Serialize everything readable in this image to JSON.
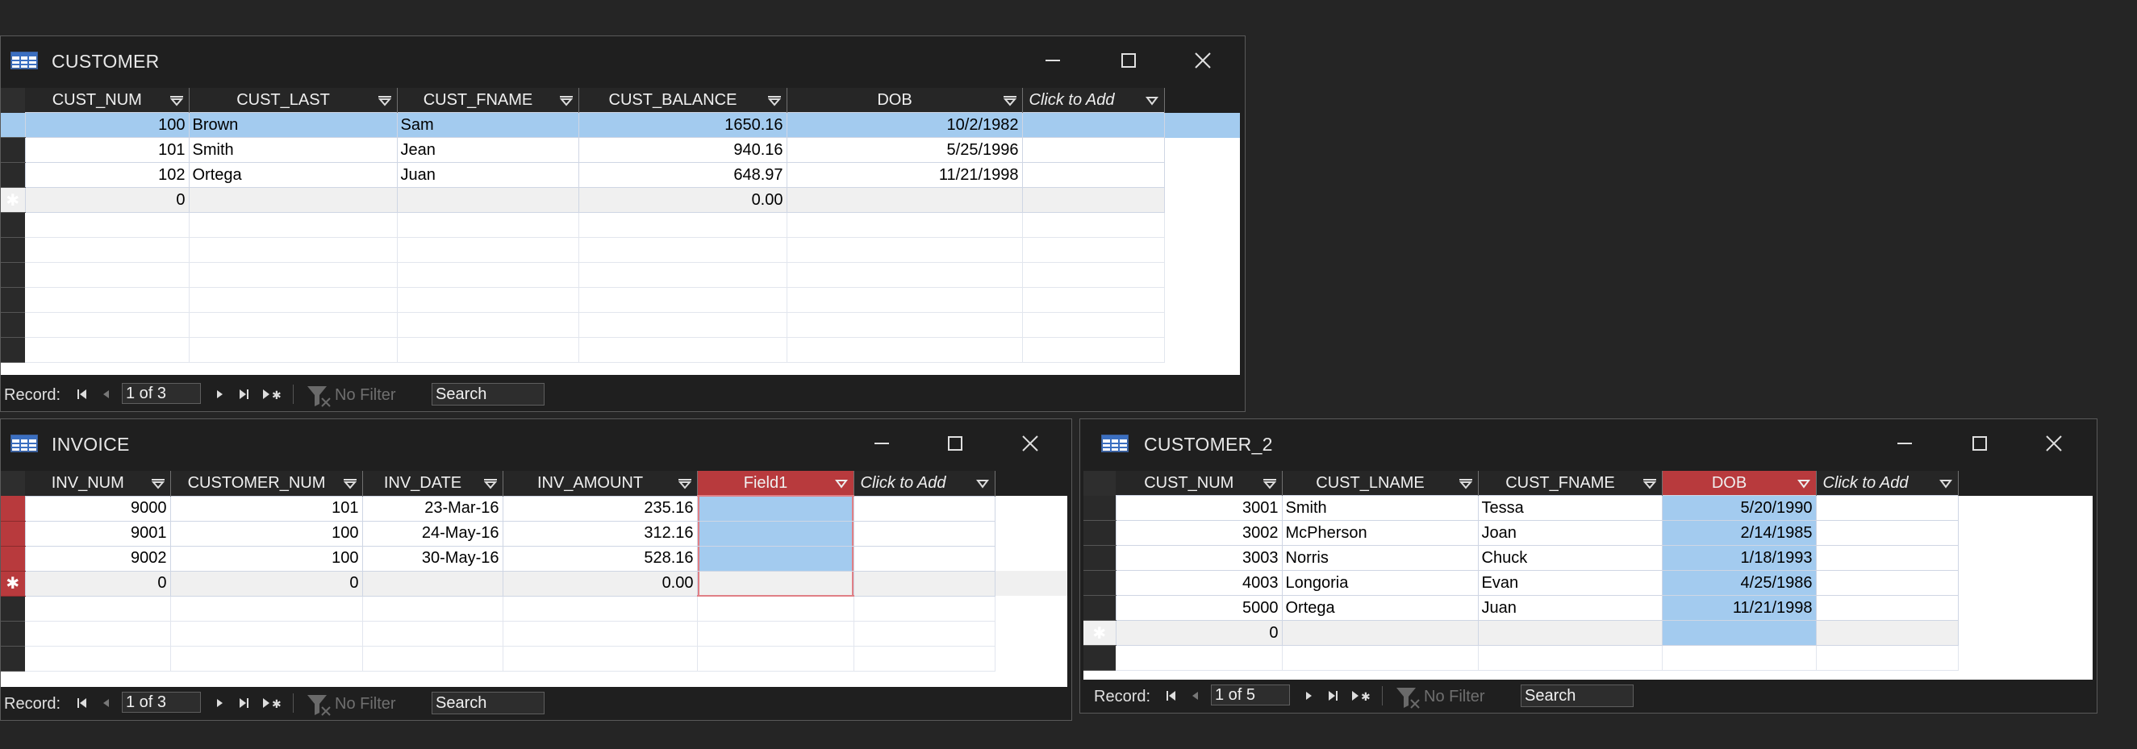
{
  "colors": {
    "app_bg": "#252525",
    "header_bg": "#262626",
    "selected_header": "#b83a3d",
    "selected_cell": "#a3cbef",
    "new_row": "#f0f0f0"
  },
  "customer": {
    "title": "CUSTOMER",
    "icon": "table-icon",
    "columns": [
      "CUST_NUM",
      "CUST_LAST",
      "CUST_FNAME",
      "CUST_BALANCE",
      "DOB",
      "Click to Add"
    ],
    "rows": [
      [
        "100",
        "Brown",
        "Sam",
        "1650.16",
        "10/2/1982"
      ],
      [
        "101",
        "Smith",
        "Jean",
        "940.16",
        "5/25/1996"
      ],
      [
        "102",
        "Ortega",
        "Juan",
        "648.97",
        "11/21/1998"
      ]
    ],
    "new_row": [
      "0",
      "",
      "",
      "0.00",
      ""
    ],
    "new_row_marker": "✱",
    "nav": {
      "label": "Record:",
      "position": "1 of 3",
      "filter": "No Filter",
      "search": "Search"
    }
  },
  "invoice": {
    "title": "INVOICE",
    "icon": "table-icon",
    "columns": [
      "INV_NUM",
      "CUSTOMER_NUM",
      "INV_DATE",
      "INV_AMOUNT",
      "Field1",
      "Click to Add"
    ],
    "rows": [
      [
        "9000",
        "101",
        "23-Mar-16",
        "235.16",
        ""
      ],
      [
        "9001",
        "100",
        "24-May-16",
        "312.16",
        ""
      ],
      [
        "9002",
        "100",
        "30-May-16",
        "528.16",
        ""
      ]
    ],
    "new_row": [
      "0",
      "0",
      "",
      "0.00",
      ""
    ],
    "new_row_marker": "✱",
    "nav": {
      "label": "Record:",
      "position": "1 of 3",
      "filter": "No Filter",
      "search": "Search"
    }
  },
  "customer2": {
    "title": "CUSTOMER_2",
    "icon": "table-icon",
    "columns": [
      "CUST_NUM",
      "CUST_LNAME",
      "CUST_FNAME",
      "DOB",
      "Click to Add"
    ],
    "rows": [
      [
        "3001",
        "Smith",
        "Tessa",
        "5/20/1990"
      ],
      [
        "3002",
        "McPherson",
        "Joan",
        "2/14/1985"
      ],
      [
        "3003",
        "Norris",
        "Chuck",
        "1/18/1993"
      ],
      [
        "4003",
        "Longoria",
        "Evan",
        "4/25/1986"
      ],
      [
        "5000",
        "Ortega",
        "Juan",
        "11/21/1998"
      ]
    ],
    "new_row": [
      "0",
      "",
      "",
      ""
    ],
    "new_row_marker": "✱",
    "nav": {
      "label": "Record:",
      "position": "1 of 5",
      "filter": "No Filter",
      "search": "Search"
    }
  }
}
